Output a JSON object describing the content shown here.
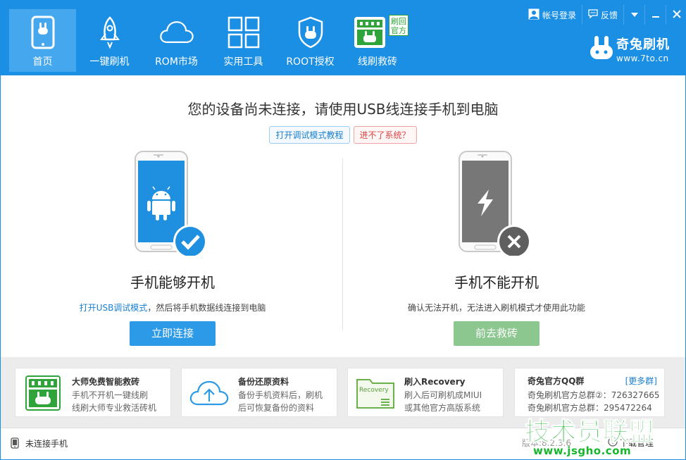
{
  "header": {
    "nav": [
      {
        "label": "首页",
        "icon": "phone-bunny-icon",
        "active": true
      },
      {
        "label": "一键刷机",
        "icon": "rocket-icon"
      },
      {
        "label": "ROM市场",
        "icon": "cloud-icon"
      },
      {
        "label": "实用工具",
        "icon": "grid-icon"
      },
      {
        "label": "ROOT授权",
        "icon": "shield-icon"
      },
      {
        "label": "线刷救砖",
        "icon": "flash-rescue-icon",
        "badge": "刷回官方"
      }
    ],
    "login_label": "帐号登录",
    "feedback_label": "反馈",
    "brand_name": "奇兔刷机",
    "brand_url": "www.7to.cn"
  },
  "main": {
    "title": "您的设备尚未连接，请使用USB线连接手机到电脑",
    "tutorial_link": "打开调试模式教程",
    "no_system_link": "进不了系统？",
    "left": {
      "title": "手机能够开机",
      "desc_highlight": "打开USB调试模式",
      "desc_rest": "，然后将手机数据线连接到电脑",
      "button": "立即连接"
    },
    "right": {
      "title": "手机不能开机",
      "desc": "确认无法开机，无法进入刷机模式才使用此功能",
      "button": "前去救砖"
    }
  },
  "cards": [
    {
      "title": "大师免费智能救砖",
      "line1": "手机不开机一键线刷",
      "line2": "线刷大师专业救活砖机",
      "icon": "rescue-master-icon"
    },
    {
      "title": "备份还原资料",
      "line1": "备份手机资料后，刷机",
      "line2": "后可恢复备份的资料",
      "icon": "cloud-upload-icon"
    },
    {
      "title": "刷入Recovery",
      "line1": "刷入后可刷机成MIUI",
      "line2": "或其他官方高版系统",
      "icon": "recovery-folder-icon",
      "icon_text": "Recovery"
    }
  ],
  "qq": {
    "title": "奇兔官方QQ群",
    "more": "[更多群]",
    "line1": "奇兔刷机官方总群②：726327665",
    "line2": "奇兔刷机官方总群：295472264"
  },
  "status": {
    "text": "未连接手机",
    "version": "版本:8.2.3.6",
    "download": "下载管理"
  },
  "watermark": {
    "title": "技术员联盟",
    "url": "www.jsgho.com"
  },
  "colors": {
    "header": "#1b8fe4",
    "accent_blue": "#2c9ae6",
    "rescue_green": "#8bc78f",
    "link_blue": "#1b7fcf",
    "link_red": "#e04545"
  }
}
